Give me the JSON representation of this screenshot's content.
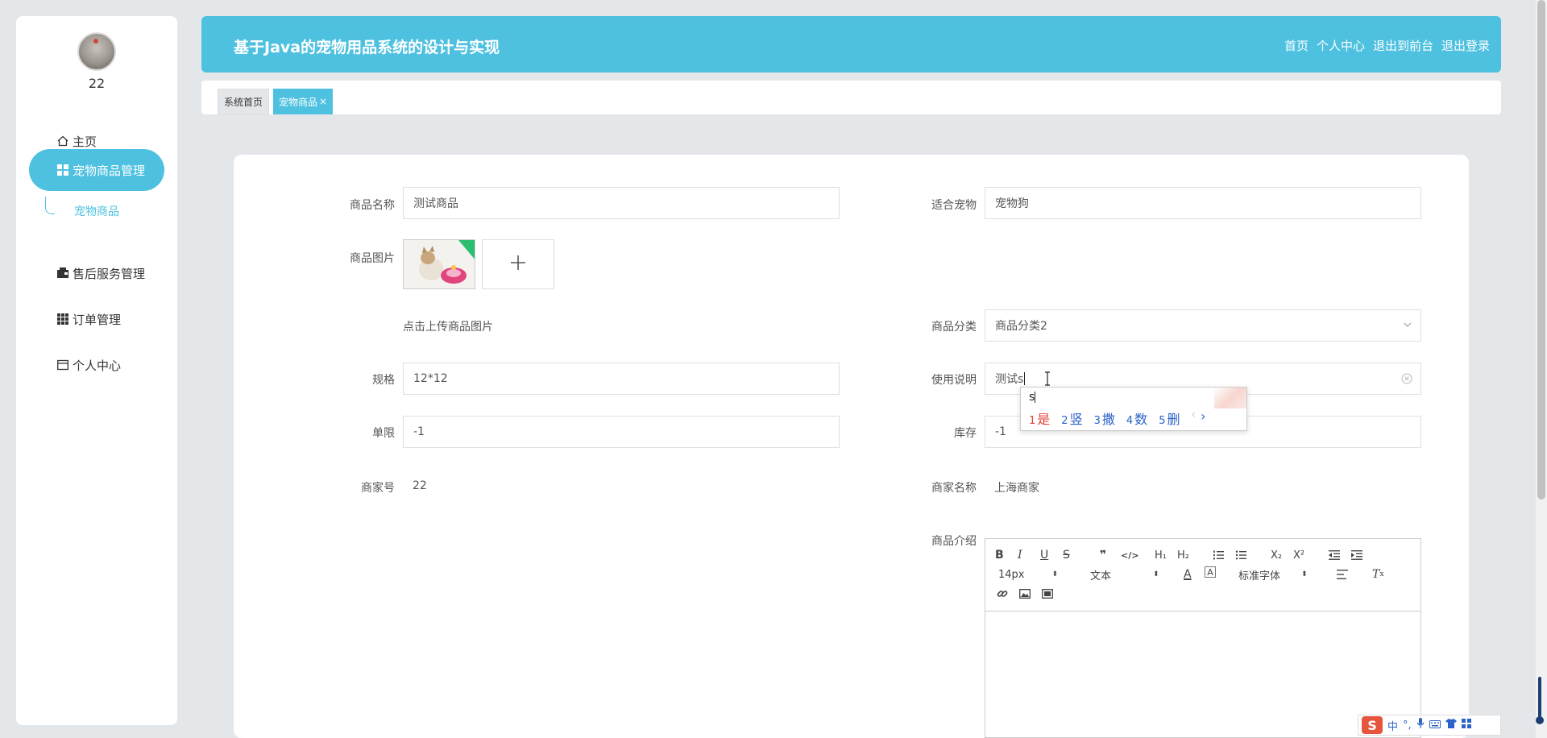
{
  "sidebar": {
    "username": "22",
    "items": [
      {
        "label": "主页",
        "icon": "home-icon"
      },
      {
        "label": "宠物商品管理",
        "icon": "grid-icon"
      },
      {
        "label": "售后服务管理",
        "icon": "wallet-icon"
      },
      {
        "label": "订单管理",
        "icon": "apps-icon"
      },
      {
        "label": "个人中心",
        "icon": "card-icon"
      }
    ],
    "submenu_label": "宠物商品"
  },
  "header": {
    "title": "基于Java的宠物用品系统的设计与实现",
    "links": [
      "首页",
      "个人中心",
      "退出到前台",
      "退出登录"
    ]
  },
  "tabs": [
    "系统首页",
    "宠物商品"
  ],
  "form": {
    "name_label": "商品名称",
    "name_value": "测试商品",
    "pet_label": "适合宠物",
    "pet_value": "宠物狗",
    "image_label": "商品图片",
    "upload_hint": "点击上传商品图片",
    "category_label": "商品分类",
    "category_value": "商品分类2",
    "spec_label": "规格",
    "spec_value": "12*12",
    "usage_label": "使用说明",
    "usage_value": "测试s",
    "limit_label": "单限",
    "limit_value": "-1",
    "stock_label": "库存",
    "stock_value": "-1",
    "merchant_no_label": "商家号",
    "merchant_no_value": "22",
    "merchant_name_label": "商家名称",
    "merchant_name_value": "上海商家",
    "intro_label": "商品介绍"
  },
  "ime": {
    "composition": "s",
    "candidates": [
      {
        "num": "1",
        "text": "是"
      },
      {
        "num": "2",
        "text": "竖"
      },
      {
        "num": "3",
        "text": "撒"
      },
      {
        "num": "4",
        "text": "数"
      },
      {
        "num": "5",
        "text": "删"
      }
    ],
    "next": "›",
    "status_lang": "中"
  },
  "editor": {
    "font_size": "14px",
    "header_select": "文本",
    "font_select": "标准字体"
  },
  "colors": {
    "accent": "#4fc1e0",
    "background": "#e4e7ea"
  }
}
